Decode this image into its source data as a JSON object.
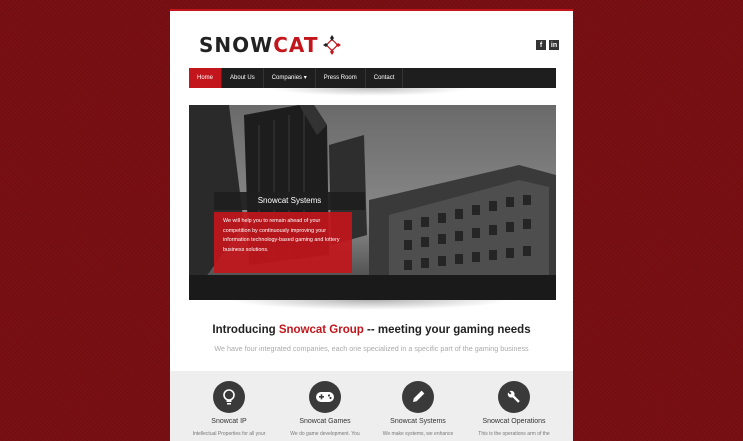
{
  "brand": {
    "name_part1": "SNOW",
    "name_part2": "CAT",
    "accent_color": "#c2161c"
  },
  "social": [
    {
      "icon": "facebook-icon",
      "label": "f"
    },
    {
      "icon": "linkedin-icon",
      "label": "in"
    }
  ],
  "nav": {
    "items": [
      {
        "label": "Home",
        "active": true
      },
      {
        "label": "About Us"
      },
      {
        "label": "Companies ▾"
      },
      {
        "label": "Press Room"
      },
      {
        "label": "Contact"
      }
    ]
  },
  "hero": {
    "caption_title": "Snowcat Systems",
    "caption_body": "We will help you to remain ahead of your competition by continuously improving your information technology-based gaming and lottery business solutions."
  },
  "intro": {
    "prefix": "Introducing ",
    "highlight": "Snowcat Group",
    "suffix": " -- meeting your gaming needs",
    "subtitle": "We have four integrated companies, each one specialized in a specific part of the gaming business"
  },
  "features": [
    {
      "icon": "lightbulb-icon",
      "title": "Snowcat IP",
      "text": "Intellectual Properties for all your"
    },
    {
      "icon": "gamepad-icon",
      "title": "Snowcat Games",
      "text": "We do game development. You"
    },
    {
      "icon": "pencil-icon",
      "title": "Snowcat Systems",
      "text": "We make systems, we enhance"
    },
    {
      "icon": "wrench-icon",
      "title": "Snowcat Operations",
      "text": "This is the operations arm of the"
    }
  ]
}
